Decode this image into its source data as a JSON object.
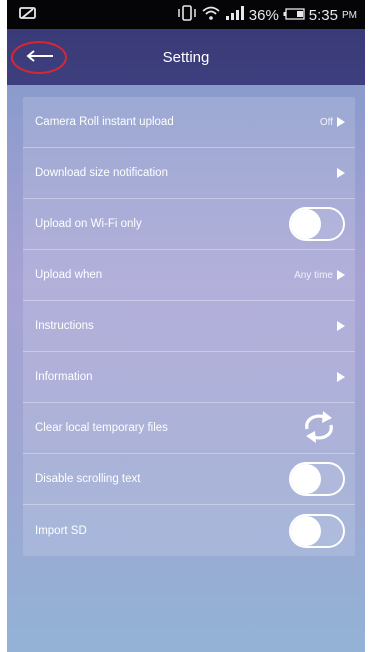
{
  "status_bar": {
    "battery_percent": "36%",
    "time": "5:35",
    "ampm": "PM",
    "icons": [
      "image-icon",
      "vibrate-icon",
      "wifi-icon",
      "signal-icon",
      "battery-icon"
    ]
  },
  "header": {
    "title": "Setting",
    "back_icon": "arrow-left-icon"
  },
  "settings": {
    "camera_roll": {
      "label": "Camera Roll instant upload",
      "value": "Off"
    },
    "download_size": {
      "label": "Download size notification"
    },
    "wifi_only": {
      "label": "Upload on Wi-Fi only",
      "enabled": false
    },
    "upload_when": {
      "label": "Upload when",
      "value": "Any time"
    },
    "instructions": {
      "label": "Instructions"
    },
    "information": {
      "label": "Information"
    },
    "clear_temp": {
      "label": "Clear local temporary files",
      "icon": "refresh-icon"
    },
    "disable_scroll": {
      "label": "Disable scrolling text",
      "enabled": false
    },
    "import_sd": {
      "label": "Import SD",
      "enabled": false
    }
  },
  "colors": {
    "header": "#3e3f7e",
    "highlight_circle": "#d92731",
    "status_bar": "#050508"
  }
}
